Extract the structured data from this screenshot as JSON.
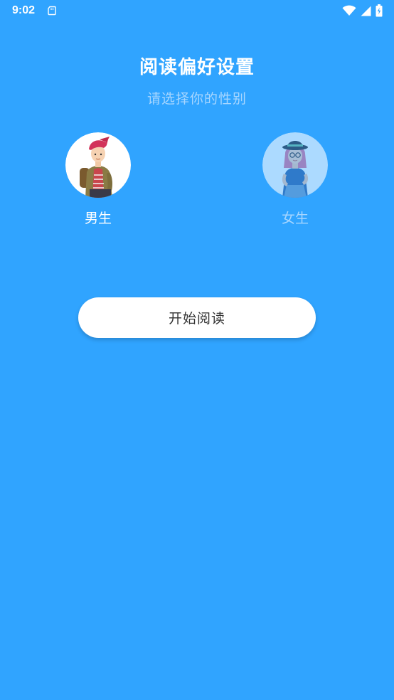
{
  "status_bar": {
    "time": "9:02",
    "icons": [
      "sd-card-icon",
      "wifi-icon",
      "cellular-signal-icon",
      "battery-charging-icon"
    ]
  },
  "heading": {
    "title": "阅读偏好设置",
    "subtitle": "请选择你的性别"
  },
  "genders": {
    "male": {
      "label": "男生",
      "selected": true
    },
    "female": {
      "label": "女生",
      "selected": false
    }
  },
  "actions": {
    "start_label": "开始阅读"
  },
  "colors": {
    "background": "#30a4ff",
    "subtitle": "#a7d6ff",
    "button_bg": "#ffffff",
    "button_text": "#333333"
  }
}
